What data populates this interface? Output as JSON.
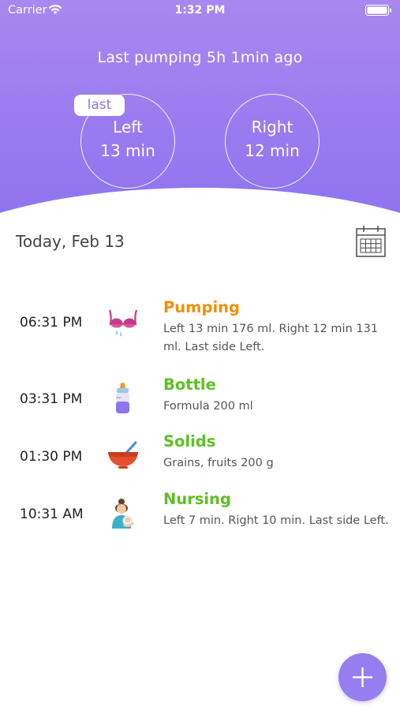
{
  "status_bar": {
    "carrier": "Carrier",
    "time": "1:32 PM"
  },
  "header": {
    "last_pumping": "Last pumping 5h 1min ago",
    "last_badge": "last",
    "left": {
      "side": "Left",
      "duration": "13 min"
    },
    "right": {
      "side": "Right",
      "duration": "12 min"
    }
  },
  "date_title": "Today, Feb 13",
  "entries": [
    {
      "time": "06:31 PM",
      "title": "Pumping",
      "detail": "Left 13 min 176 ml. Right 12 min 131 ml. Last side Left.",
      "icon": "pumping-icon",
      "color": "#f0900c"
    },
    {
      "time": "03:31 PM",
      "title": "Bottle",
      "detail": "Formula 200 ml",
      "icon": "bottle-icon",
      "color": "#5ec025"
    },
    {
      "time": "01:30 PM",
      "title": "Solids",
      "detail": "Grains, fruits 200 g",
      "icon": "bowl-icon",
      "color": "#5ec025"
    },
    {
      "time": "10:31 AM",
      "title": "Nursing",
      "detail": "Left 7 min. Right 10 min. Last side Left.",
      "icon": "nursing-icon",
      "color": "#5ec025"
    }
  ],
  "colors": {
    "accent": "#967ef1",
    "header_top": "#a788ee",
    "pumping": "#f0900c",
    "feeding": "#5ec025"
  }
}
